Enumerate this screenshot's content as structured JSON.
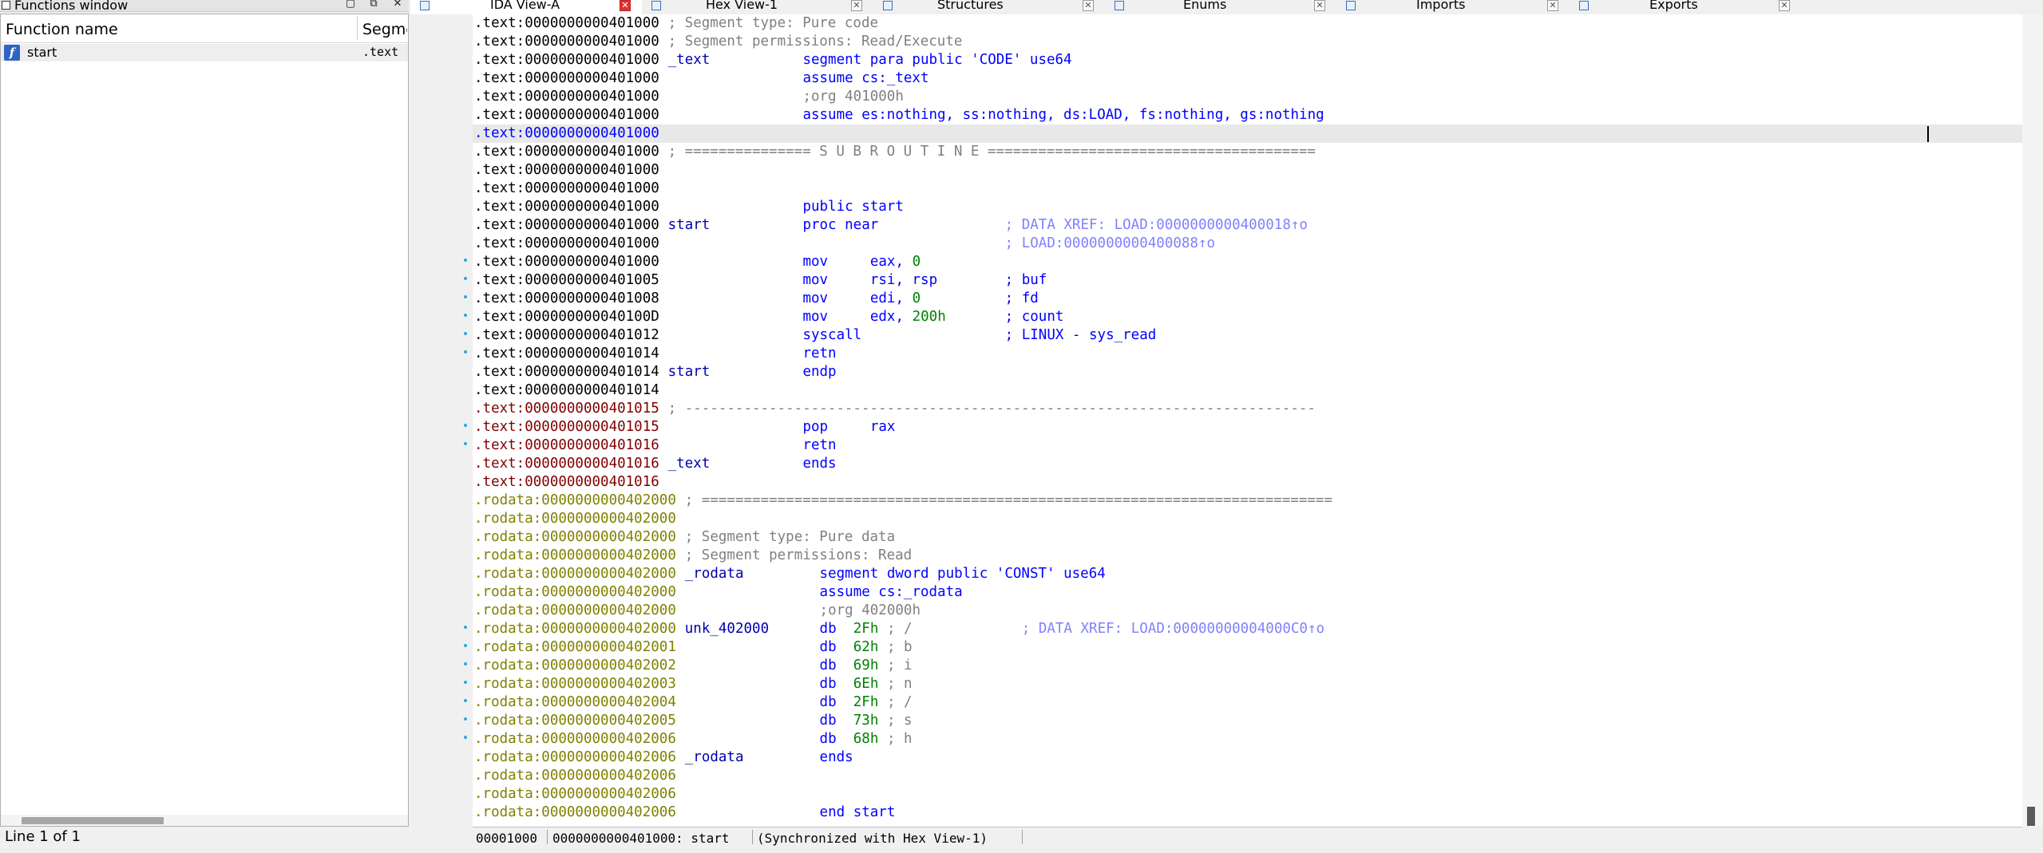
{
  "functions_window": {
    "title": "Functions window",
    "col_name": "Function name",
    "col_segment": "Segme",
    "rows": [
      {
        "icon": "f",
        "name": "start",
        "segment": ".text"
      }
    ],
    "status": "Line 1 of 1"
  },
  "tabs": [
    {
      "label": "IDA View-A",
      "icon": "disasm-icon",
      "active": true
    },
    {
      "label": "Hex View-1",
      "icon": "hex-icon",
      "active": false
    },
    {
      "label": "Structures",
      "icon": "struct-icon",
      "active": false
    },
    {
      "label": "Enums",
      "icon": "enum-icon",
      "active": false
    },
    {
      "label": "Imports",
      "icon": "imports-icon",
      "active": false
    },
    {
      "label": "Exports",
      "icon": "exports-icon",
      "active": false
    }
  ],
  "disassembly": {
    "lines": [
      {
        "addr": ".text:0000000000401000",
        "kind": "text",
        "parts": [
          {
            "t": " ; Segment type: Pure code",
            "c": "comment",
            "col": 22
          }
        ]
      },
      {
        "addr": ".text:0000000000401000",
        "kind": "text",
        "parts": [
          {
            "t": " ; Segment permissions: Read/Execute",
            "c": "comment",
            "col": 22
          }
        ]
      },
      {
        "addr": ".text:0000000000401000",
        "kind": "text",
        "parts": [
          {
            "t": "_text",
            "c": "label",
            "col": 23
          },
          {
            "t": "segment para public 'CODE' use64",
            "c": "instr",
            "col": 39
          }
        ]
      },
      {
        "addr": ".text:0000000000401000",
        "kind": "text",
        "parts": [
          {
            "t": "assume cs:_text",
            "c": "instr",
            "col": 39
          }
        ]
      },
      {
        "addr": ".text:0000000000401000",
        "kind": "text",
        "parts": [
          {
            "t": ";org 401000h",
            "c": "dircom",
            "col": 39
          }
        ]
      },
      {
        "addr": ".text:0000000000401000",
        "kind": "text",
        "parts": [
          {
            "t": "assume es:nothing, ss:nothing, ds:LOAD, fs:nothing, gs:nothing",
            "c": "instr",
            "col": 39
          }
        ]
      },
      {
        "addr": ".text:0000000000401000",
        "kind": "text",
        "hl": true,
        "addrcolor": "instr",
        "parts": []
      },
      {
        "addr": ".text:0000000000401000",
        "kind": "text",
        "parts": [
          {
            "t": " ; =============== S U B R O U T I N E =======================================",
            "c": "sep",
            "col": 22
          }
        ]
      },
      {
        "addr": ".text:0000000000401000",
        "kind": "text",
        "parts": []
      },
      {
        "addr": ".text:0000000000401000",
        "kind": "text",
        "parts": []
      },
      {
        "addr": ".text:0000000000401000",
        "kind": "text",
        "parts": [
          {
            "t": "public start",
            "c": "instr",
            "col": 39
          }
        ]
      },
      {
        "addr": ".text:0000000000401000",
        "kind": "text",
        "parts": [
          {
            "t": "start",
            "c": "label",
            "col": 23
          },
          {
            "t": "proc near",
            "c": "instr",
            "col": 39
          },
          {
            "t": "; DATA XREF: LOAD:0000000000400018↑o",
            "c": "xref",
            "col": 63
          }
        ]
      },
      {
        "addr": ".text:0000000000401000",
        "kind": "text",
        "parts": [
          {
            "t": "; LOAD:0000000000400088↑o",
            "c": "xref",
            "col": 63
          }
        ]
      },
      {
        "addr": ".text:0000000000401000",
        "kind": "text",
        "dot": true,
        "parts": [
          {
            "t": "mov",
            "c": "instr",
            "col": 39
          },
          {
            "t": "eax, ",
            "c": "instr",
            "col": 47
          },
          {
            "t": "0",
            "c": "num",
            "col": 52
          }
        ]
      },
      {
        "addr": ".text:0000000000401005",
        "kind": "text",
        "dot": true,
        "parts": [
          {
            "t": "mov",
            "c": "instr",
            "col": 39
          },
          {
            "t": "rsi, rsp",
            "c": "instr",
            "col": 47
          },
          {
            "t": "; buf",
            "c": "instr",
            "col": 63
          }
        ]
      },
      {
        "addr": ".text:0000000000401008",
        "kind": "text",
        "dot": true,
        "parts": [
          {
            "t": "mov",
            "c": "instr",
            "col": 39
          },
          {
            "t": "edi, ",
            "c": "instr",
            "col": 47
          },
          {
            "t": "0",
            "c": "num",
            "col": 52
          },
          {
            "t": "; fd",
            "c": "instr",
            "col": 63
          }
        ]
      },
      {
        "addr": ".text:000000000040100D",
        "kind": "text",
        "dot": true,
        "parts": [
          {
            "t": "mov",
            "c": "instr",
            "col": 39
          },
          {
            "t": "edx, ",
            "c": "instr",
            "col": 47
          },
          {
            "t": "200h",
            "c": "num",
            "col": 52
          },
          {
            "t": "; count",
            "c": "instr",
            "col": 63
          }
        ]
      },
      {
        "addr": ".text:0000000000401012",
        "kind": "text",
        "dot": true,
        "parts": [
          {
            "t": "syscall",
            "c": "instr",
            "col": 39
          },
          {
            "t": "; LINUX - sys_read",
            "c": "instr",
            "col": 63
          }
        ]
      },
      {
        "addr": ".text:0000000000401014",
        "kind": "text",
        "dot": true,
        "parts": [
          {
            "t": "retn",
            "c": "instr",
            "col": 39
          }
        ]
      },
      {
        "addr": ".text:0000000000401014",
        "kind": "text",
        "parts": [
          {
            "t": "start",
            "c": "label",
            "col": 23
          },
          {
            "t": "endp",
            "c": "instr",
            "col": 39
          }
        ]
      },
      {
        "addr": ".text:0000000000401014",
        "kind": "text",
        "parts": []
      },
      {
        "addr": ".text:0000000000401015",
        "kind": "red",
        "parts": [
          {
            "t": " ; ---------------------------------------------------------------------------",
            "c": "sep",
            "col": 22
          }
        ]
      },
      {
        "addr": ".text:0000000000401015",
        "kind": "red",
        "dot": true,
        "parts": [
          {
            "t": "pop",
            "c": "instr",
            "col": 39
          },
          {
            "t": "rax",
            "c": "instr",
            "col": 47
          }
        ]
      },
      {
        "addr": ".text:0000000000401016",
        "kind": "red",
        "dot": true,
        "parts": [
          {
            "t": "retn",
            "c": "instr",
            "col": 39
          }
        ]
      },
      {
        "addr": ".text:0000000000401016",
        "kind": "red",
        "parts": [
          {
            "t": "_text",
            "c": "label",
            "col": 23
          },
          {
            "t": "ends",
            "c": "instr",
            "col": 39
          }
        ]
      },
      {
        "addr": ".text:0000000000401016",
        "kind": "red",
        "parts": []
      },
      {
        "addr": ".rodata:0000000000402000",
        "kind": "ro",
        "parts": [
          {
            "t": " ; ===========================================================================",
            "c": "sep",
            "col": 24
          }
        ]
      },
      {
        "addr": ".rodata:0000000000402000",
        "kind": "ro",
        "parts": []
      },
      {
        "addr": ".rodata:0000000000402000",
        "kind": "ro",
        "parts": [
          {
            "t": " ; Segment type: Pure data",
            "c": "comment",
            "col": 24
          }
        ]
      },
      {
        "addr": ".rodata:0000000000402000",
        "kind": "ro",
        "parts": [
          {
            "t": " ; Segment permissions: Read",
            "c": "comment",
            "col": 24
          }
        ]
      },
      {
        "addr": ".rodata:0000000000402000",
        "kind": "ro",
        "parts": [
          {
            "t": "_rodata",
            "c": "label",
            "col": 25
          },
          {
            "t": "segment dword public 'CONST' use64",
            "c": "instr",
            "col": 41
          }
        ]
      },
      {
        "addr": ".rodata:0000000000402000",
        "kind": "ro",
        "parts": [
          {
            "t": "assume cs:_rodata",
            "c": "instr",
            "col": 41
          }
        ]
      },
      {
        "addr": ".rodata:0000000000402000",
        "kind": "ro",
        "parts": [
          {
            "t": ";org 402000h",
            "c": "dircom",
            "col": 41
          }
        ]
      },
      {
        "addr": ".rodata:0000000000402000",
        "kind": "ro",
        "dot": true,
        "parts": [
          {
            "t": "unk_402000",
            "c": "label",
            "col": 25
          },
          {
            "t": "db",
            "c": "instr",
            "col": 41
          },
          {
            "t": "2Fh",
            "c": "num",
            "col": 45
          },
          {
            "t": "; /",
            "c": "dircom",
            "col": 49
          },
          {
            "t": "; DATA XREF: LOAD:00000000004000C0↑o",
            "c": "xref",
            "col": 65
          }
        ]
      },
      {
        "addr": ".rodata:0000000000402001",
        "kind": "ro",
        "dot": true,
        "parts": [
          {
            "t": "db",
            "c": "instr",
            "col": 41
          },
          {
            "t": "62h",
            "c": "num",
            "col": 45
          },
          {
            "t": "; b",
            "c": "dircom",
            "col": 49
          }
        ]
      },
      {
        "addr": ".rodata:0000000000402002",
        "kind": "ro",
        "dot": true,
        "parts": [
          {
            "t": "db",
            "c": "instr",
            "col": 41
          },
          {
            "t": "69h",
            "c": "num",
            "col": 45
          },
          {
            "t": "; i",
            "c": "dircom",
            "col": 49
          }
        ]
      },
      {
        "addr": ".rodata:0000000000402003",
        "kind": "ro",
        "dot": true,
        "parts": [
          {
            "t": "db",
            "c": "instr",
            "col": 41
          },
          {
            "t": "6Eh",
            "c": "num",
            "col": 45
          },
          {
            "t": "; n",
            "c": "dircom",
            "col": 49
          }
        ]
      },
      {
        "addr": ".rodata:0000000000402004",
        "kind": "ro",
        "dot": true,
        "parts": [
          {
            "t": "db",
            "c": "instr",
            "col": 41
          },
          {
            "t": "2Fh",
            "c": "num",
            "col": 45
          },
          {
            "t": "; /",
            "c": "dircom",
            "col": 49
          }
        ]
      },
      {
        "addr": ".rodata:0000000000402005",
        "kind": "ro",
        "dot": true,
        "parts": [
          {
            "t": "db",
            "c": "instr",
            "col": 41
          },
          {
            "t": "73h",
            "c": "num",
            "col": 45
          },
          {
            "t": "; s",
            "c": "dircom",
            "col": 49
          }
        ]
      },
      {
        "addr": ".rodata:0000000000402006",
        "kind": "ro",
        "dot": true,
        "parts": [
          {
            "t": "db",
            "c": "instr",
            "col": 41
          },
          {
            "t": "68h",
            "c": "num",
            "col": 45
          },
          {
            "t": "; h",
            "c": "dircom",
            "col": 49
          }
        ]
      },
      {
        "addr": ".rodata:0000000000402006",
        "kind": "ro",
        "parts": [
          {
            "t": "_rodata",
            "c": "label",
            "col": 25
          },
          {
            "t": "ends",
            "c": "instr",
            "col": 41
          }
        ]
      },
      {
        "addr": ".rodata:0000000000402006",
        "kind": "ro",
        "parts": []
      },
      {
        "addr": ".rodata:0000000000402006",
        "kind": "ro",
        "parts": []
      },
      {
        "addr": ".rodata:0000000000402006",
        "kind": "ro",
        "parts": [
          {
            "t": "end start",
            "c": "instr",
            "col": 41
          }
        ]
      }
    ]
  },
  "statusbar": {
    "offset": "00001000",
    "location": "0000000000401000: start",
    "sync": "(Synchronized with Hex View-1)"
  },
  "colors": {
    "addr_text": "#000000",
    "addr_red": "#800000",
    "addr_rodata": "#808000",
    "instr": "#0000ff",
    "label": "#0000b0",
    "number": "#008000",
    "comment": "#808080",
    "xref": "#8080ff"
  }
}
